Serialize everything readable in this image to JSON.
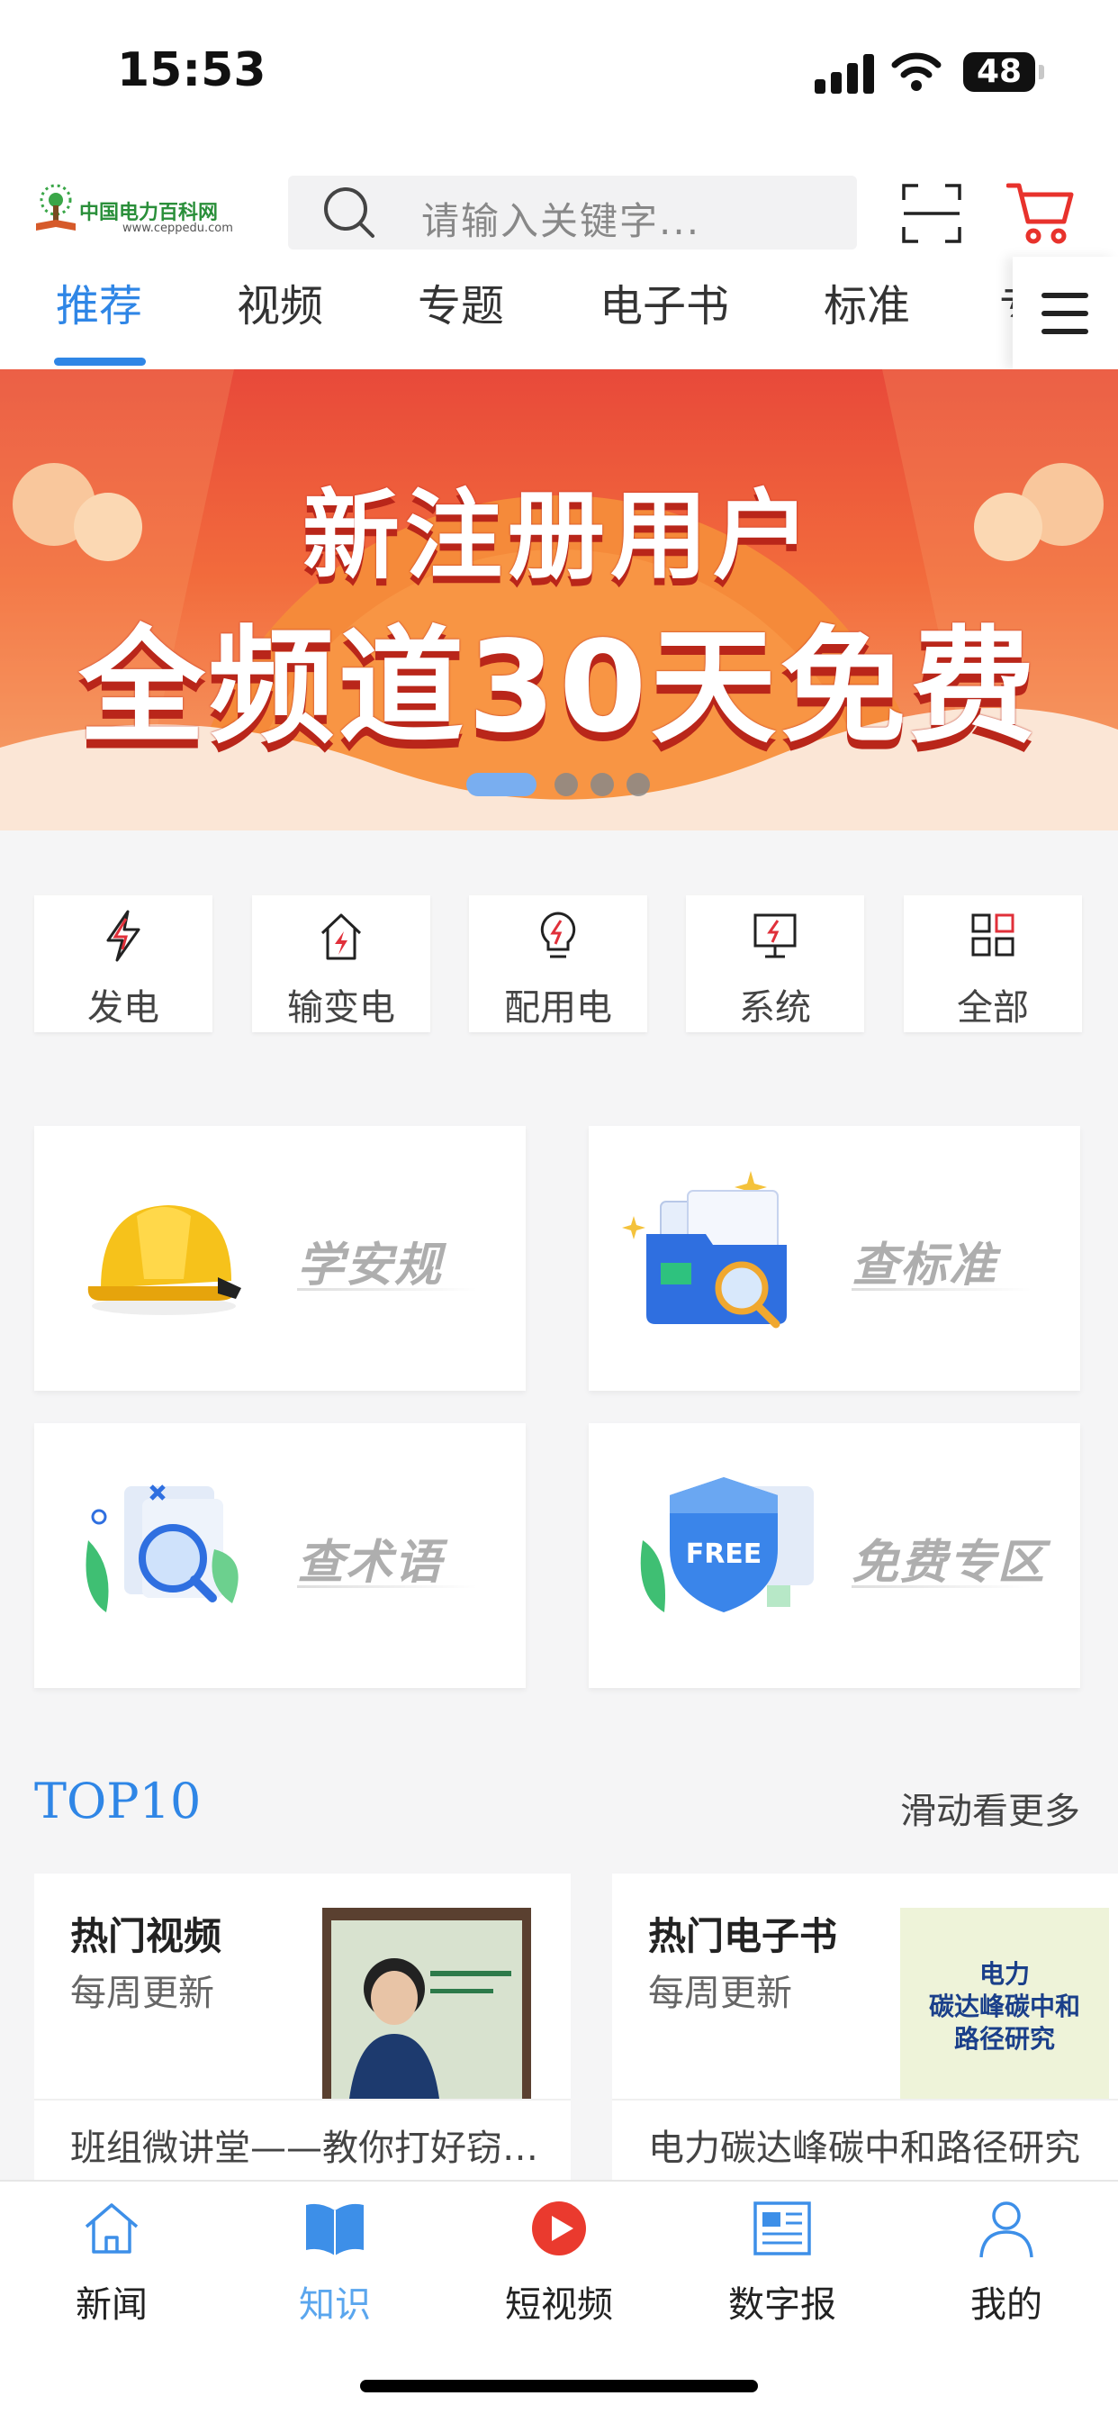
{
  "status_bar": {
    "time": "15:53",
    "battery": "48"
  },
  "header": {
    "logo_text": "中国电力百科网",
    "logo_url": "www.ceppedu.com",
    "search_placeholder": "请输入关键字..."
  },
  "tabs": [
    {
      "label": "推荐",
      "active": true
    },
    {
      "label": "视频"
    },
    {
      "label": "专题"
    },
    {
      "label": "电子书"
    },
    {
      "label": "标准"
    },
    {
      "label": "专"
    }
  ],
  "banner": {
    "line1": "新注册用户",
    "line2": "全频道30天免费",
    "slides": 4,
    "active_slide": 1
  },
  "categories": [
    {
      "label": "发电",
      "icon": "lightning-bolt-icon"
    },
    {
      "label": "输变电",
      "icon": "substation-icon"
    },
    {
      "label": "配用电",
      "icon": "bulb-icon"
    },
    {
      "label": "系统",
      "icon": "monitor-icon"
    },
    {
      "label": "全部",
      "icon": "grid-icon"
    }
  ],
  "features": [
    {
      "title": "学安规",
      "icon": "safety-helmet-icon"
    },
    {
      "title": "查标准",
      "icon": "folder-search-icon"
    },
    {
      "title": "查术语",
      "icon": "magnifier-document-icon"
    },
    {
      "title": "免费专区",
      "icon": "free-shield-icon",
      "badge": "FREE"
    }
  ],
  "top10": {
    "title": "TOP10",
    "more": "滑动看更多",
    "cards": [
      {
        "title": "热门视频",
        "subtitle": "每周更新",
        "item": "班组微讲堂——教你打好窃…"
      },
      {
        "title": "热门电子书",
        "subtitle": "每周更新",
        "item": "电力碳达峰碳中和路径研究",
        "cover_text": "电力\n碳达峰碳中和\n路径研究"
      }
    ]
  },
  "bottom_nav": [
    {
      "label": "新闻",
      "icon": "home-icon"
    },
    {
      "label": "知识",
      "icon": "book-icon",
      "active": true
    },
    {
      "label": "短视频",
      "icon": "play-icon"
    },
    {
      "label": "数字报",
      "icon": "newspaper-icon"
    },
    {
      "label": "我的",
      "icon": "user-icon"
    }
  ],
  "colors": {
    "accent": "#2f86e6",
    "banner": "#f26b3c",
    "nav_active": "#5aa6ee"
  }
}
